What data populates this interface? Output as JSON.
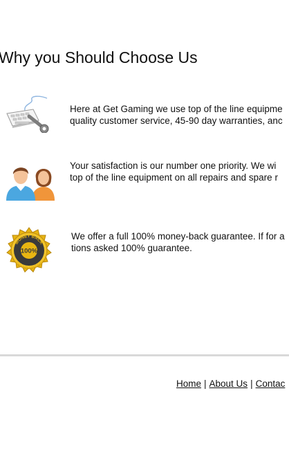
{
  "section": {
    "title": "Why you Should Choose Us"
  },
  "features": [
    {
      "icon": "keyboard-wrench-icon",
      "lines": [
        "Here at Get Gaming we use top of the line equipme",
        "quality customer service, 45-90 day warranties, anc"
      ]
    },
    {
      "icon": "customers-icon",
      "lines": [
        "Your satisfaction is our number one priority. We wi",
        "top of the line equipment on all repairs and spare r"
      ]
    },
    {
      "icon": "money-back-guarantee-badge",
      "badge_text": [
        "MONEY BACK",
        "100%",
        "GUARANTEE"
      ],
      "lines": [
        "We offer a full 100% money-back guarantee. If for a",
        "tions asked 100% guarantee."
      ]
    }
  ],
  "footer": {
    "links": [
      "Home",
      "About Us",
      "Contac"
    ],
    "separator": "|"
  },
  "colors": {
    "divider": "#d9d9d9",
    "badge_gold": "#e8b512",
    "badge_dark": "#3a3a3a"
  }
}
